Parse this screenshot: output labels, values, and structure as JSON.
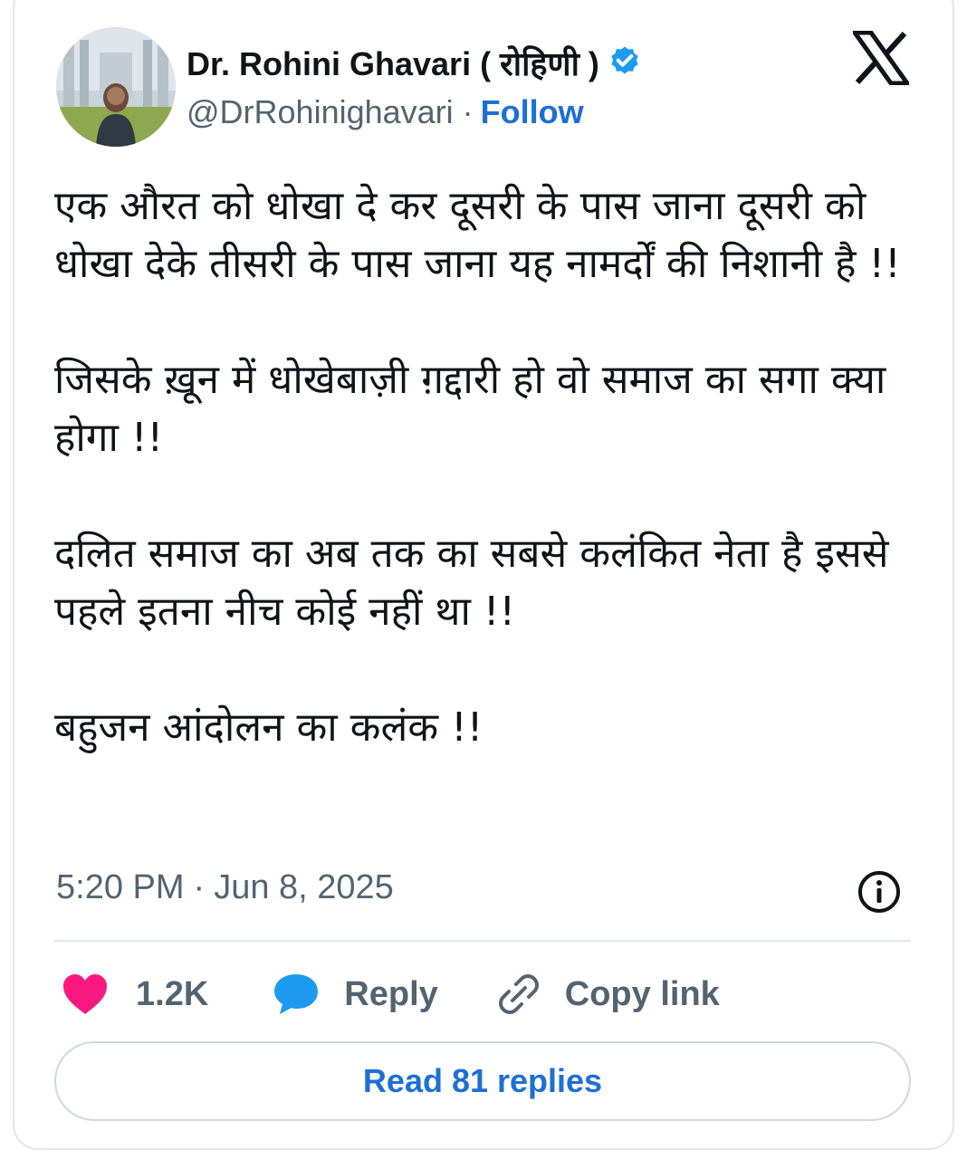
{
  "author": {
    "display_name": "Dr. Rohini Ghavari ( रोहिणी )",
    "handle": "@DrRohinighavari",
    "separator": "·",
    "follow_label": "Follow",
    "verified": true
  },
  "tweet": {
    "paragraphs": [
      "एक औरत को धोखा दे कर दूसरी के पास जाना दूसरी को धोखा देके तीसरी के पास जाना यह नामर्दों की निशानी है !!",
      "जिसके ख़ून में धोखेबाज़ी ग़द्दारी हो वो समाज का सगा क्या होगा !!",
      "दलित समाज का अब तक का सबसे कलंकित नेता है इससे पहले इतना नीच कोई नहीं था !!",
      "बहुजन आंदोलन का कलंक !!"
    ],
    "time": "5:20 PM",
    "date_separator": "·",
    "date": "Jun 8, 2025"
  },
  "actions": {
    "like_count": "1.2K",
    "reply_label": "Reply",
    "copy_link_label": "Copy link"
  },
  "read_replies_label": "Read 81 replies",
  "icons": {
    "platform_logo": "x-logo-icon",
    "verified": "verified-badge-icon",
    "info": "info-icon",
    "like": "heart-icon",
    "reply": "speech-bubble-icon",
    "copy": "link-icon"
  },
  "colors": {
    "text": "#0f1419",
    "secondary": "#536471",
    "accent_blue": "#1d6fd6",
    "like_pink": "#f91880",
    "reply_blue": "#1d9bf0",
    "border": "#e1e6ea"
  }
}
